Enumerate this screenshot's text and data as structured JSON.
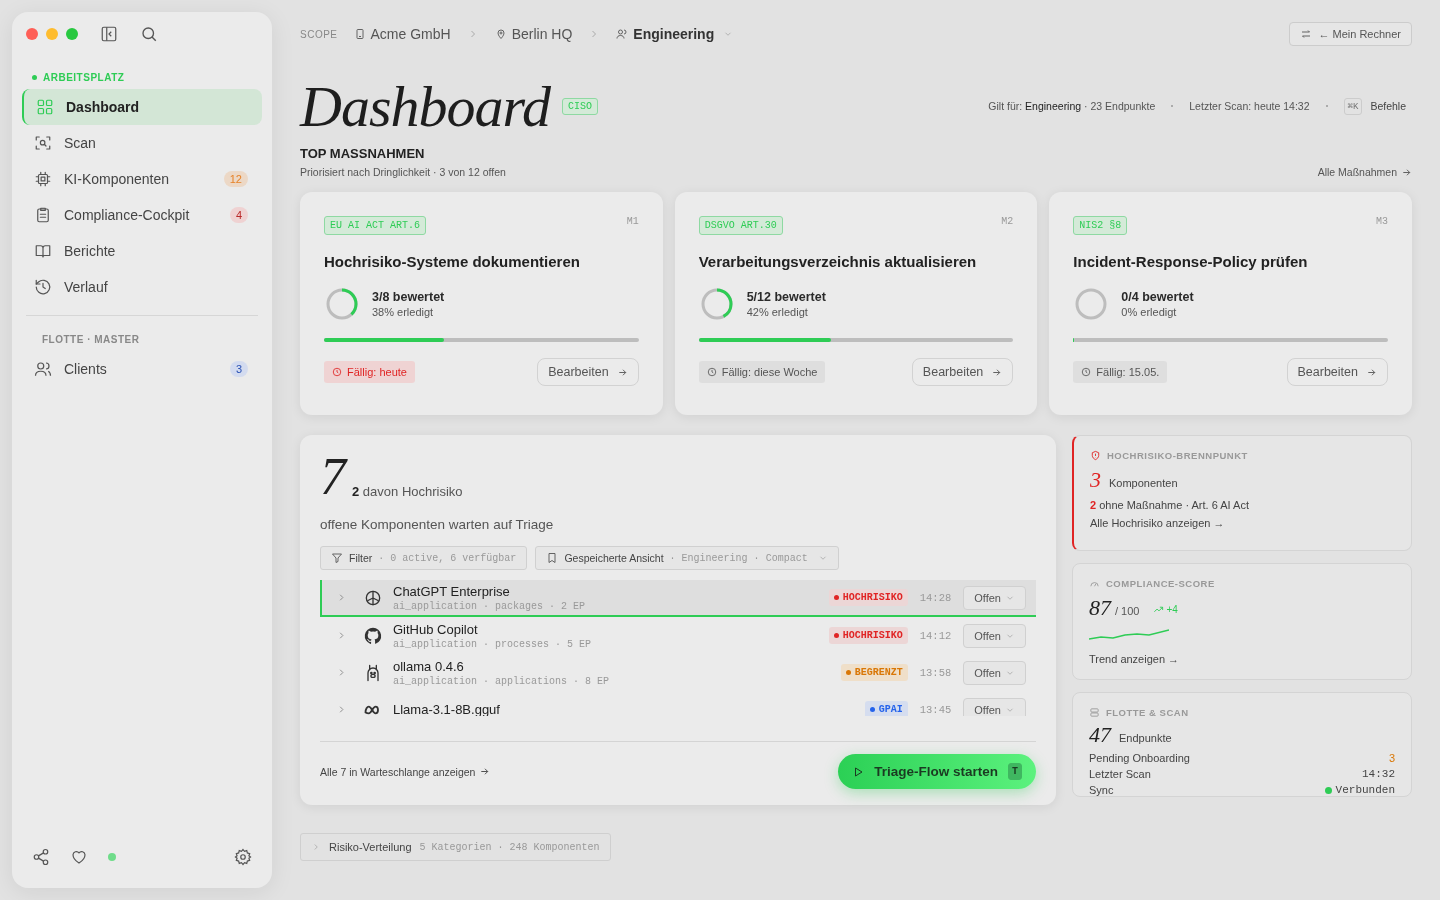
{
  "sidebar": {
    "section_label": "ARBEITSPLATZ",
    "items": [
      {
        "label": "Dashboard",
        "selected": true
      },
      {
        "label": "Scan",
        "selected": false
      },
      {
        "label": "KI-Komponenten",
        "selected": false,
        "badge": "12",
        "color": "#ecd8c6"
      },
      {
        "label": "Compliance-Cockpit",
        "selected": false,
        "badge": "4",
        "color": "#efd2d2"
      },
      {
        "label": "Berichte",
        "selected": false
      },
      {
        "label": "Verlauf",
        "selected": false
      }
    ],
    "fleet_label": "FLOTTE · MASTER",
    "fleet_items": [
      {
        "label": "Clients",
        "selected": false,
        "badge": "3",
        "color": "#d3dbef"
      }
    ]
  },
  "scope": {
    "label": "SCOPE",
    "crumbs": [
      "Acme GmbH",
      "Berlin HQ",
      "Engineering"
    ]
  },
  "switch_button": "← Mein Rechner",
  "header": {
    "title": "Dashboard",
    "badge": "CISO",
    "scope_text": "Gilt für: **Engineering** · 23 Endpunkte",
    "scan_text": "Letzter Scan: heute 14:32",
    "shortcut": "⌘K",
    "commands": "Befehle"
  },
  "actions": {
    "title": "TOP MASSNAHMEN",
    "subtitle": "Priorisiert nach Dringlichkeit · 3 von 12 offen",
    "link": "Alle Maßnahmen",
    "cards": [
      {
        "tag": "EU AI ACT ART.6",
        "id": "M1",
        "title": "Hochrisiko-Systeme dokumentieren",
        "progress": "3/8 bewertet",
        "done": "38% erledigt",
        "level": 0.38,
        "due": "Fällig: heute",
        "urgent": true,
        "button": "Bearbeiten"
      },
      {
        "tag": "DSGVO ART.30",
        "id": "M2",
        "title": "Verarbeitungsverzeichnis aktualisieren",
        "progress": "5/12 bewertet",
        "done": "42% erledigt",
        "level": 0.42,
        "due": "Fällig: diese Woche",
        "urgent": false,
        "button": "Bearbeiten"
      },
      {
        "tag": "NIS2 §8",
        "id": "M3",
        "title": "Incident-Response-Policy prüfen",
        "progress": "0/4 bewertet",
        "done": "0% erledigt",
        "level": 0,
        "due": "Fällig: 15.05.",
        "urgent": false,
        "button": "Bearbeiten"
      }
    ]
  },
  "triage": {
    "count": "7",
    "high_note": "**2** davon Hochrisiko",
    "subtitle": "offene Komponenten warten auf Triage",
    "filter": {
      "label": "Filter",
      "detail": "· 0 active, 6 verfügbar"
    },
    "view": {
      "label": "Gespeicherte Ansicht",
      "detail": "· Engineering · Compact"
    },
    "rows": [
      {
        "name": "ChatGPT Enterprise",
        "meta": "ai_application · packages · 2 EP",
        "risk": {
          "kind": "high",
          "label": "HOCHRISIKO"
        },
        "time": "14:28",
        "status": "Offen",
        "selected": true
      },
      {
        "name": "GitHub Copilot",
        "meta": "ai_application · processes · 5 EP",
        "risk": {
          "kind": "high",
          "label": "HOCHRISIKO"
        },
        "time": "14:12",
        "status": "Offen",
        "selected": false
      },
      {
        "name": "ollama 0.4.6",
        "meta": "ai_application · applications · 8 EP",
        "risk": {
          "kind": "limited",
          "label": "BEGRENZT"
        },
        "time": "13:58",
        "status": "Offen",
        "selected": false
      },
      {
        "name": "Llama-3.1-8B.gguf",
        "risk": {
          "kind": "gpai",
          "label": "GPAI"
        },
        "time": "13:45",
        "status": "Offen",
        "selected": false
      }
    ],
    "queue_link": "Alle 7 in Warteschlange anzeigen",
    "start_button": "Triage-Flow starten",
    "start_key": "T"
  },
  "hotspot": {
    "title": "HOCHRISIKO-BRENNPUNKT",
    "count": "3",
    "unit": "Komponenten",
    "note": "**2** ohne Maßnahme · Art. 6 AI Act",
    "link": "Alle Hochrisiko anzeigen →"
  },
  "score": {
    "title": "COMPLIANCE-SCORE",
    "value": "87",
    "max": "/ 100",
    "delta": "+4",
    "link": "Trend anzeigen →"
  },
  "fleet": {
    "title": "FLOTTE & SCAN",
    "count": "47",
    "unit": "Endpunkte",
    "rows": [
      {
        "label": "Pending Onboarding",
        "value": "3",
        "kind": "warn"
      },
      {
        "label": "Letzter Scan",
        "value": "14:32",
        "kind": "plain"
      },
      {
        "label": "Sync",
        "value": "Verbunden",
        "kind": "status"
      }
    ]
  },
  "distribution": {
    "label": "Risiko-Verteilung",
    "detail": "5 Kategorien · 248 Komponenten"
  }
}
